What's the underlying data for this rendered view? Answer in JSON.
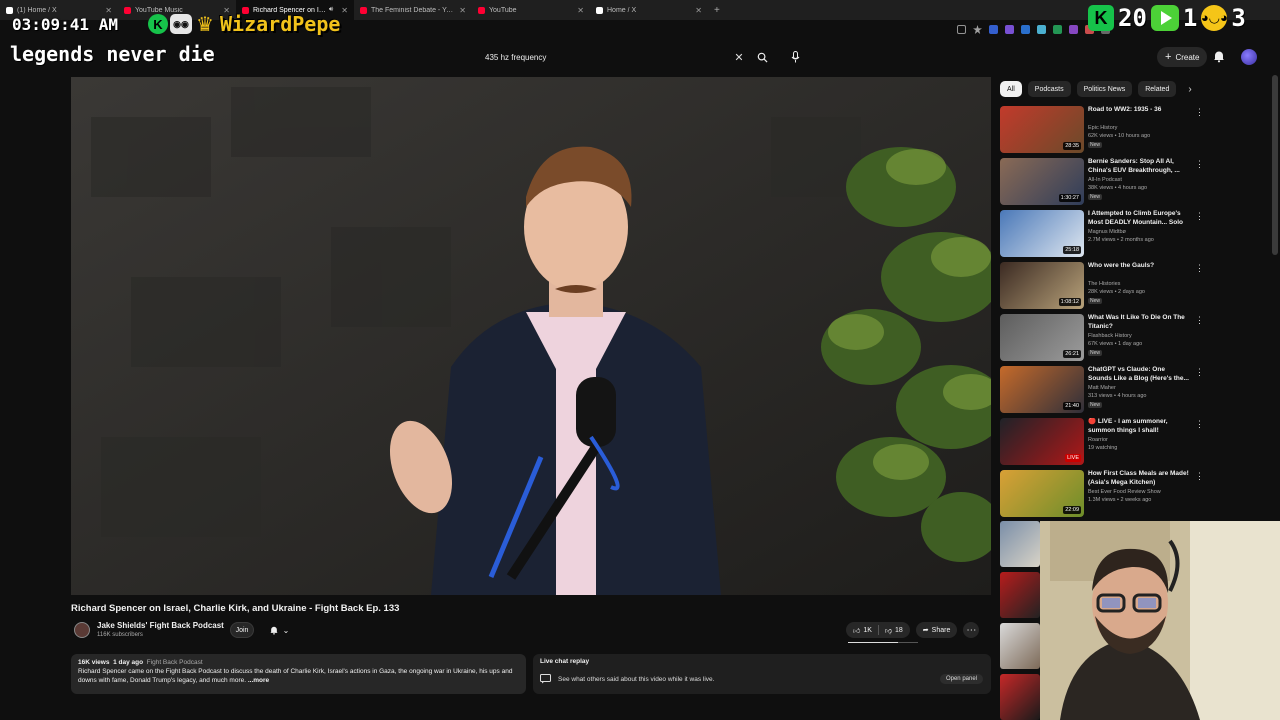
{
  "browser": {
    "tabs": [
      {
        "label": "(1) Home / X",
        "active": false,
        "favicon": "x-logo",
        "color": "#ffffff"
      },
      {
        "label": "YouTube Music",
        "active": false,
        "favicon": "youtube-music-logo",
        "color": "#ff0033"
      },
      {
        "label": "Richard Spencer on Israel, C",
        "active": true,
        "favicon": "youtube-logo",
        "color": "#ff0033"
      },
      {
        "label": "The Feminist Debate - YouTube",
        "active": false,
        "favicon": "youtube-logo",
        "color": "#ff0033"
      },
      {
        "label": "YouTube",
        "active": false,
        "favicon": "youtube-logo",
        "color": "#ff0033"
      },
      {
        "label": "Home / X",
        "active": false,
        "favicon": "x-logo",
        "color": "#ffffff"
      }
    ],
    "new_tab": "+"
  },
  "overlay": {
    "time": "03:09:41 AM",
    "username": "WizardPepe",
    "caption": "legends never die",
    "kick_letter": "K",
    "digits_a": "20",
    "digits_b": "1",
    "digits_c": "3"
  },
  "header": {
    "search_query": "435 hz frequency",
    "create_label": "Create"
  },
  "video": {
    "title": "Richard Spencer on Israel, Charlie Kirk, and Ukraine - Fight Back Ep. 133",
    "channel_name": "Jake Shields' Fight Back Podcast",
    "channel_subs": "116K subscribers",
    "join_label": "Join",
    "likes": "1K",
    "dislikes": "18",
    "share_label": "Share",
    "like_ratio": 0.72
  },
  "description": {
    "views": "16K views",
    "age": "1 day ago",
    "tag": "Fight Back Podcast",
    "text": "Richard Spencer came on the Fight Back Podcast to discuss the death of Charlie Kirk, Israel's actions in Gaza, the ongoing war in Ukraine, his ups and downs with fame, Donald Trump's legacy, and much more.",
    "more_label": "...more"
  },
  "chat": {
    "title": "Live chat replay",
    "line": "See what others said about this video while it was live.",
    "open_label": "Open panel"
  },
  "sidebar": {
    "chips": [
      "All",
      "Podcasts",
      "Politics News",
      "Related"
    ],
    "recommendations": [
      {
        "title": "Road to WW2: 1935 - 36",
        "channel": "Epic History",
        "stats": "62K views • 10 hours ago",
        "badge": "New",
        "duration": "28:35",
        "colors": [
          "#c23a2b",
          "#6b4a2a"
        ]
      },
      {
        "title": "Bernie Sanders: Stop All AI, China's EUV Breakthrough, ...",
        "channel": "All-In Podcast",
        "stats": "38K views • 4 hours ago",
        "badge": "New",
        "duration": "1:30:27",
        "colors": [
          "#8a6a55",
          "#2f3d5a"
        ]
      },
      {
        "title": "I Attempted to Climb Europe's Most DEADLY Mountain... Solo",
        "channel": "Magnus Midtbø",
        "stats": "2.7M views • 2 months ago",
        "badge": "",
        "duration": "25:18",
        "colors": [
          "#4a78b8",
          "#dfe7f0"
        ]
      },
      {
        "title": "Who were the Gauls?",
        "channel": "The Histories",
        "stats": "28K views • 2 days ago",
        "badge": "New",
        "duration": "1:08:12",
        "colors": [
          "#3b2a22",
          "#b8a27a"
        ]
      },
      {
        "title": "What Was It Like To Die On The Titanic?",
        "channel": "Flashback History",
        "stats": "67K views • 1 day ago",
        "badge": "New",
        "duration": "26:21",
        "colors": [
          "#5d5d5d",
          "#9c9c9c"
        ]
      },
      {
        "title": "ChatGPT vs Claude: One Sounds Like a Blog (Here's the...",
        "channel": "Matt Maher",
        "stats": "313 views • 4 hours ago",
        "badge": "New",
        "duration": "21:40",
        "colors": [
          "#c56a2a",
          "#2f2f3a"
        ]
      },
      {
        "title": "🔴 LIVE - I am summoner, summon things I shall!",
        "channel": "Roarrior",
        "stats": "19 watching",
        "badge": "",
        "duration": "LIVE",
        "colors": [
          "#1f2228",
          "#b01818"
        ]
      },
      {
        "title": "How First Class Meals are Made! (Asia's Mega Kitchen)",
        "channel": "Best Ever Food Review Show",
        "stats": "1.3M views • 2 weeks ago",
        "badge": "",
        "duration": "22:09",
        "colors": [
          "#d9a036",
          "#6d8e2a"
        ]
      }
    ]
  },
  "colors": {
    "background": "#0f0f0f",
    "kick_green": "#16c24a",
    "crown_gold": "#f1c21b",
    "youtube_red": "#ff0033"
  }
}
